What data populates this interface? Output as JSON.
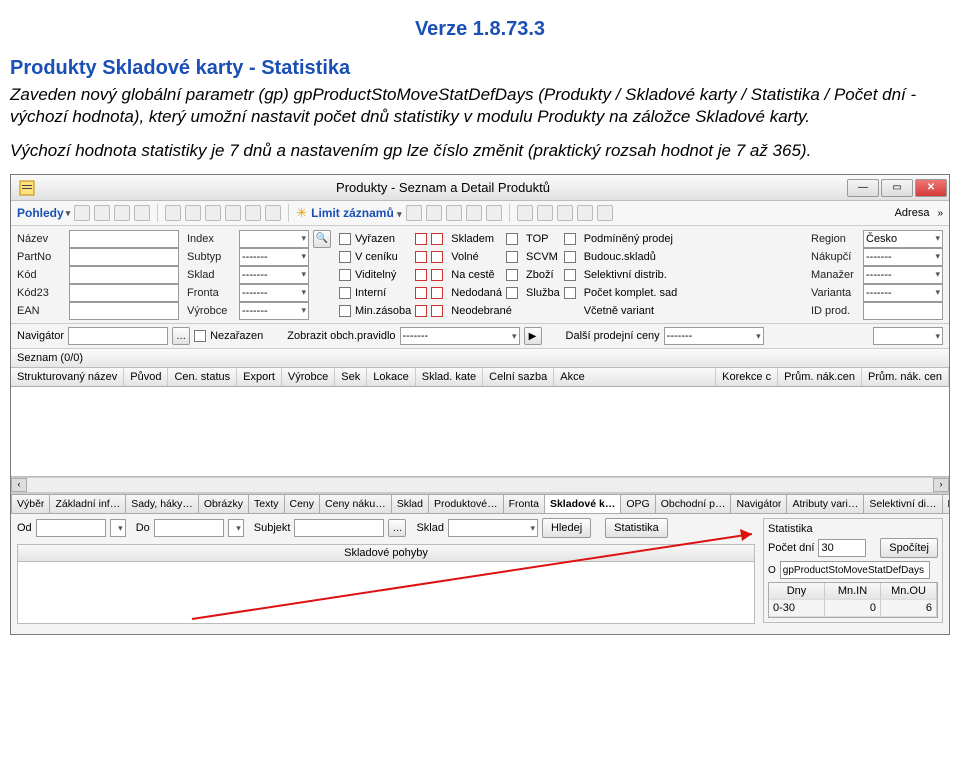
{
  "doc": {
    "version": "Verze 1.8.73.3",
    "heading": "Produkty Skladové karty - Statistika",
    "para1": "Zaveden nový globální parametr (gp) gpProductStoMoveStatDefDays (Produkty / Skladové karty / Statistika / Počet dní - výchozí hodnota), který umožní nastavit počet dnů statistiky v modulu Produkty na záložce Skladové karty.",
    "para2": "Výchozí hodnota statistiky je 7 dnů a nastavením gp lze číslo změnit (praktický rozsah hodnot je 7 až 365)."
  },
  "window": {
    "title": "Produkty - Seznam a Detail Produktů"
  },
  "toolbar": {
    "pohledy": "Pohledy",
    "limit": "Limit záznamů",
    "adresa": "Adresa"
  },
  "filters_left": {
    "nazev": "Název",
    "partno": "PartNo",
    "kod": "Kód",
    "kod23": "Kód23",
    "ean": "EAN",
    "index": "Index",
    "subtyp": "Subtyp",
    "sklad": "Sklad",
    "fronta": "Fronta",
    "vyrobce": "Výrobce"
  },
  "filter_cols": {
    "c1": [
      "Vyřazen",
      "V ceníku",
      "Viditelný",
      "Interní",
      "Min.zásoba"
    ],
    "c2": [
      "Skladem",
      "Volné",
      "Na cestě",
      "Nedodaná",
      "Neodebrané"
    ],
    "c3": [
      "TOP",
      "SCVM",
      "Zboží",
      "Služba",
      ""
    ],
    "c4": [
      "Podmíněný prodej",
      "Budouc.skladů",
      "Selektivní distrib.",
      "Počet komplet. sad",
      "Včetně variant"
    ]
  },
  "filters_right": {
    "region": "Region",
    "region_val": "Česko",
    "nakupci": "Nákupčí",
    "manazer": "Manažer",
    "varianta": "Varianta",
    "idprod": "ID prod."
  },
  "navrow": {
    "navigator": "Navigátor",
    "nezarazen": "Nezařazen",
    "zobrazit": "Zobrazit obch.pravidlo",
    "dalsi": "Další prodejní ceny"
  },
  "seznam": "Seznam (0/0)",
  "grid_cols": [
    "Strukturovaný název",
    "Původ",
    "Cen. status",
    "Export",
    "Výrobce",
    "Sek",
    "Lokace",
    "Sklad. kate",
    "Celní sazba",
    "Akce",
    "Korekce c",
    "Prům. nák.cen",
    "Prům. nák. cen"
  ],
  "tabs": [
    "Výběr",
    "Základní inf…",
    "Sady, háky…",
    "Obrázky",
    "Texty",
    "Ceny",
    "Ceny náku…",
    "Sklad",
    "Produktové…",
    "Fronta",
    "Skladové k…",
    "OPG",
    "Obchodní p…",
    "Navigátor",
    "Atributy vari…",
    "Selektivní di…",
    "Licence"
  ],
  "detail": {
    "od": "Od",
    "do": "Do",
    "subjekt": "Subjekt",
    "sklad": "Sklad",
    "hledej": "Hledej",
    "statistika_btn": "Statistika",
    "sklad_pohyby": "Skladové pohyby"
  },
  "stat": {
    "title": "Statistika",
    "pocet_dni": "Počet dní",
    "pocet_dni_val": "30",
    "spocitej": "Spočítej",
    "gp": "gpProductStoMoveStatDefDays",
    "cols": [
      "Dny",
      "Mn.IN",
      "Mn.OU"
    ],
    "row": [
      "0-30",
      "0",
      "6"
    ]
  }
}
